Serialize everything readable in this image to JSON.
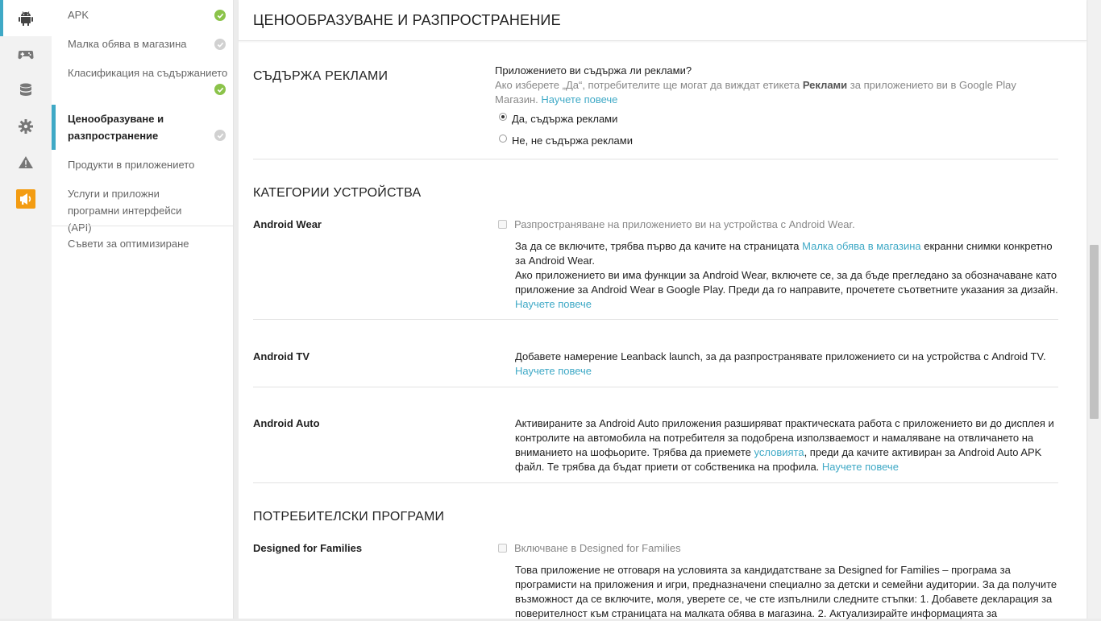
{
  "rail": {
    "items": [
      {
        "name": "android-icon",
        "active": true
      },
      {
        "name": "gamepad-icon",
        "active": false
      },
      {
        "name": "database-icon",
        "active": false
      },
      {
        "name": "gear-icon",
        "active": false
      },
      {
        "name": "alert-icon",
        "active": false
      },
      {
        "name": "megaphone-icon",
        "active": false
      }
    ],
    "accent_color": "#3fa9c6",
    "promo_color": "#f39c12"
  },
  "nav": {
    "items": [
      {
        "label": "APK",
        "status": "complete"
      },
      {
        "label": "Малка обява в магазина",
        "status": "pending"
      },
      {
        "label": "Класификация на съдържанието",
        "status": "complete"
      },
      {
        "label": "Ценообразуване и разпространение",
        "status": "pending",
        "active": true
      },
      {
        "label": "Продукти в приложението"
      },
      {
        "label": "Услуги и приложни програмни интерфейси (API)"
      },
      {
        "label": "Съвети за оптимизиране"
      }
    ]
  },
  "page": {
    "title": "ЦЕНООБРАЗУВАНЕ И РАЗПРОСТРАНЕНИЕ"
  },
  "ads": {
    "heading": "СЪДЪРЖА РЕКЛАМИ",
    "question": "Приложението ви съдържа ли реклами?",
    "help_before": "Ако изберете „Да“, потребителите ще могат да виждат етикета ",
    "help_bold": "Реклами",
    "help_after": " за приложението ви в Google Play Магазин. ",
    "learn_more": "Научете повече",
    "options": [
      {
        "label": "Да, съдържа реклами",
        "checked": true
      },
      {
        "label": "Не, не съдържа реклами",
        "checked": false
      }
    ]
  },
  "device_categories": {
    "heading": "КАТЕГОРИИ УСТРОЙСТВА",
    "wear": {
      "label": "Android Wear",
      "checkbox_label": "Разпространяване на приложението ви на устройства с Android Wear.",
      "p1_before": "За да се включите, трябва първо да качите на страницата ",
      "p1_link": "Малка обява в магазина",
      "p1_after": " екранни снимки конкретно за Android Wear.",
      "p2": "Ако приложението ви има функции за Android Wear, включете се, за да бъде прегледано за обозначаване като приложение за Android Wear в Google Play. Преди да го направите, прочетете съответните указания за дизайн. ",
      "learn_more": "Научете повече"
    },
    "tv": {
      "label": "Android TV",
      "text": "Добавете намерение Leanback launch, за да разпространявате приложението си на устройства с Android TV.",
      "learn_more": "Научете повече"
    },
    "auto": {
      "label": "Android Auto",
      "text_before": "Активираните за Android Auto приложения разширяват практическата работа с приложението ви до дисплея и контролите на автомобила на потребителя за подобрена използваемост и намаляване на отвличането на вниманието на шофьорите. Трябва да приемете ",
      "terms_link": "условията",
      "text_after": ", преди да качите активиран за Android Auto APK файл. Те трябва да бъдат приети от собственика на профила. ",
      "learn_more": "Научете повече"
    }
  },
  "user_programs": {
    "heading": "ПОТРЕБИТЕЛСКИ ПРОГРАМИ",
    "families": {
      "label": "Designed for Families",
      "checkbox_label": "Включване в Designed for Families",
      "text": "Това приложение не отговаря на условията за кандидатстване за Designed for Families – програма за програмисти на приложения и игри, предназначени специално за детски и семейни аудитории. За да получите възможност да се включите, моля, уверете се, че сте изпълнили следните стъпки: 1. Добавете декларация за поверителност към страницата на малката обява в магазина. 2. Актуализирайте информацията за"
    }
  }
}
